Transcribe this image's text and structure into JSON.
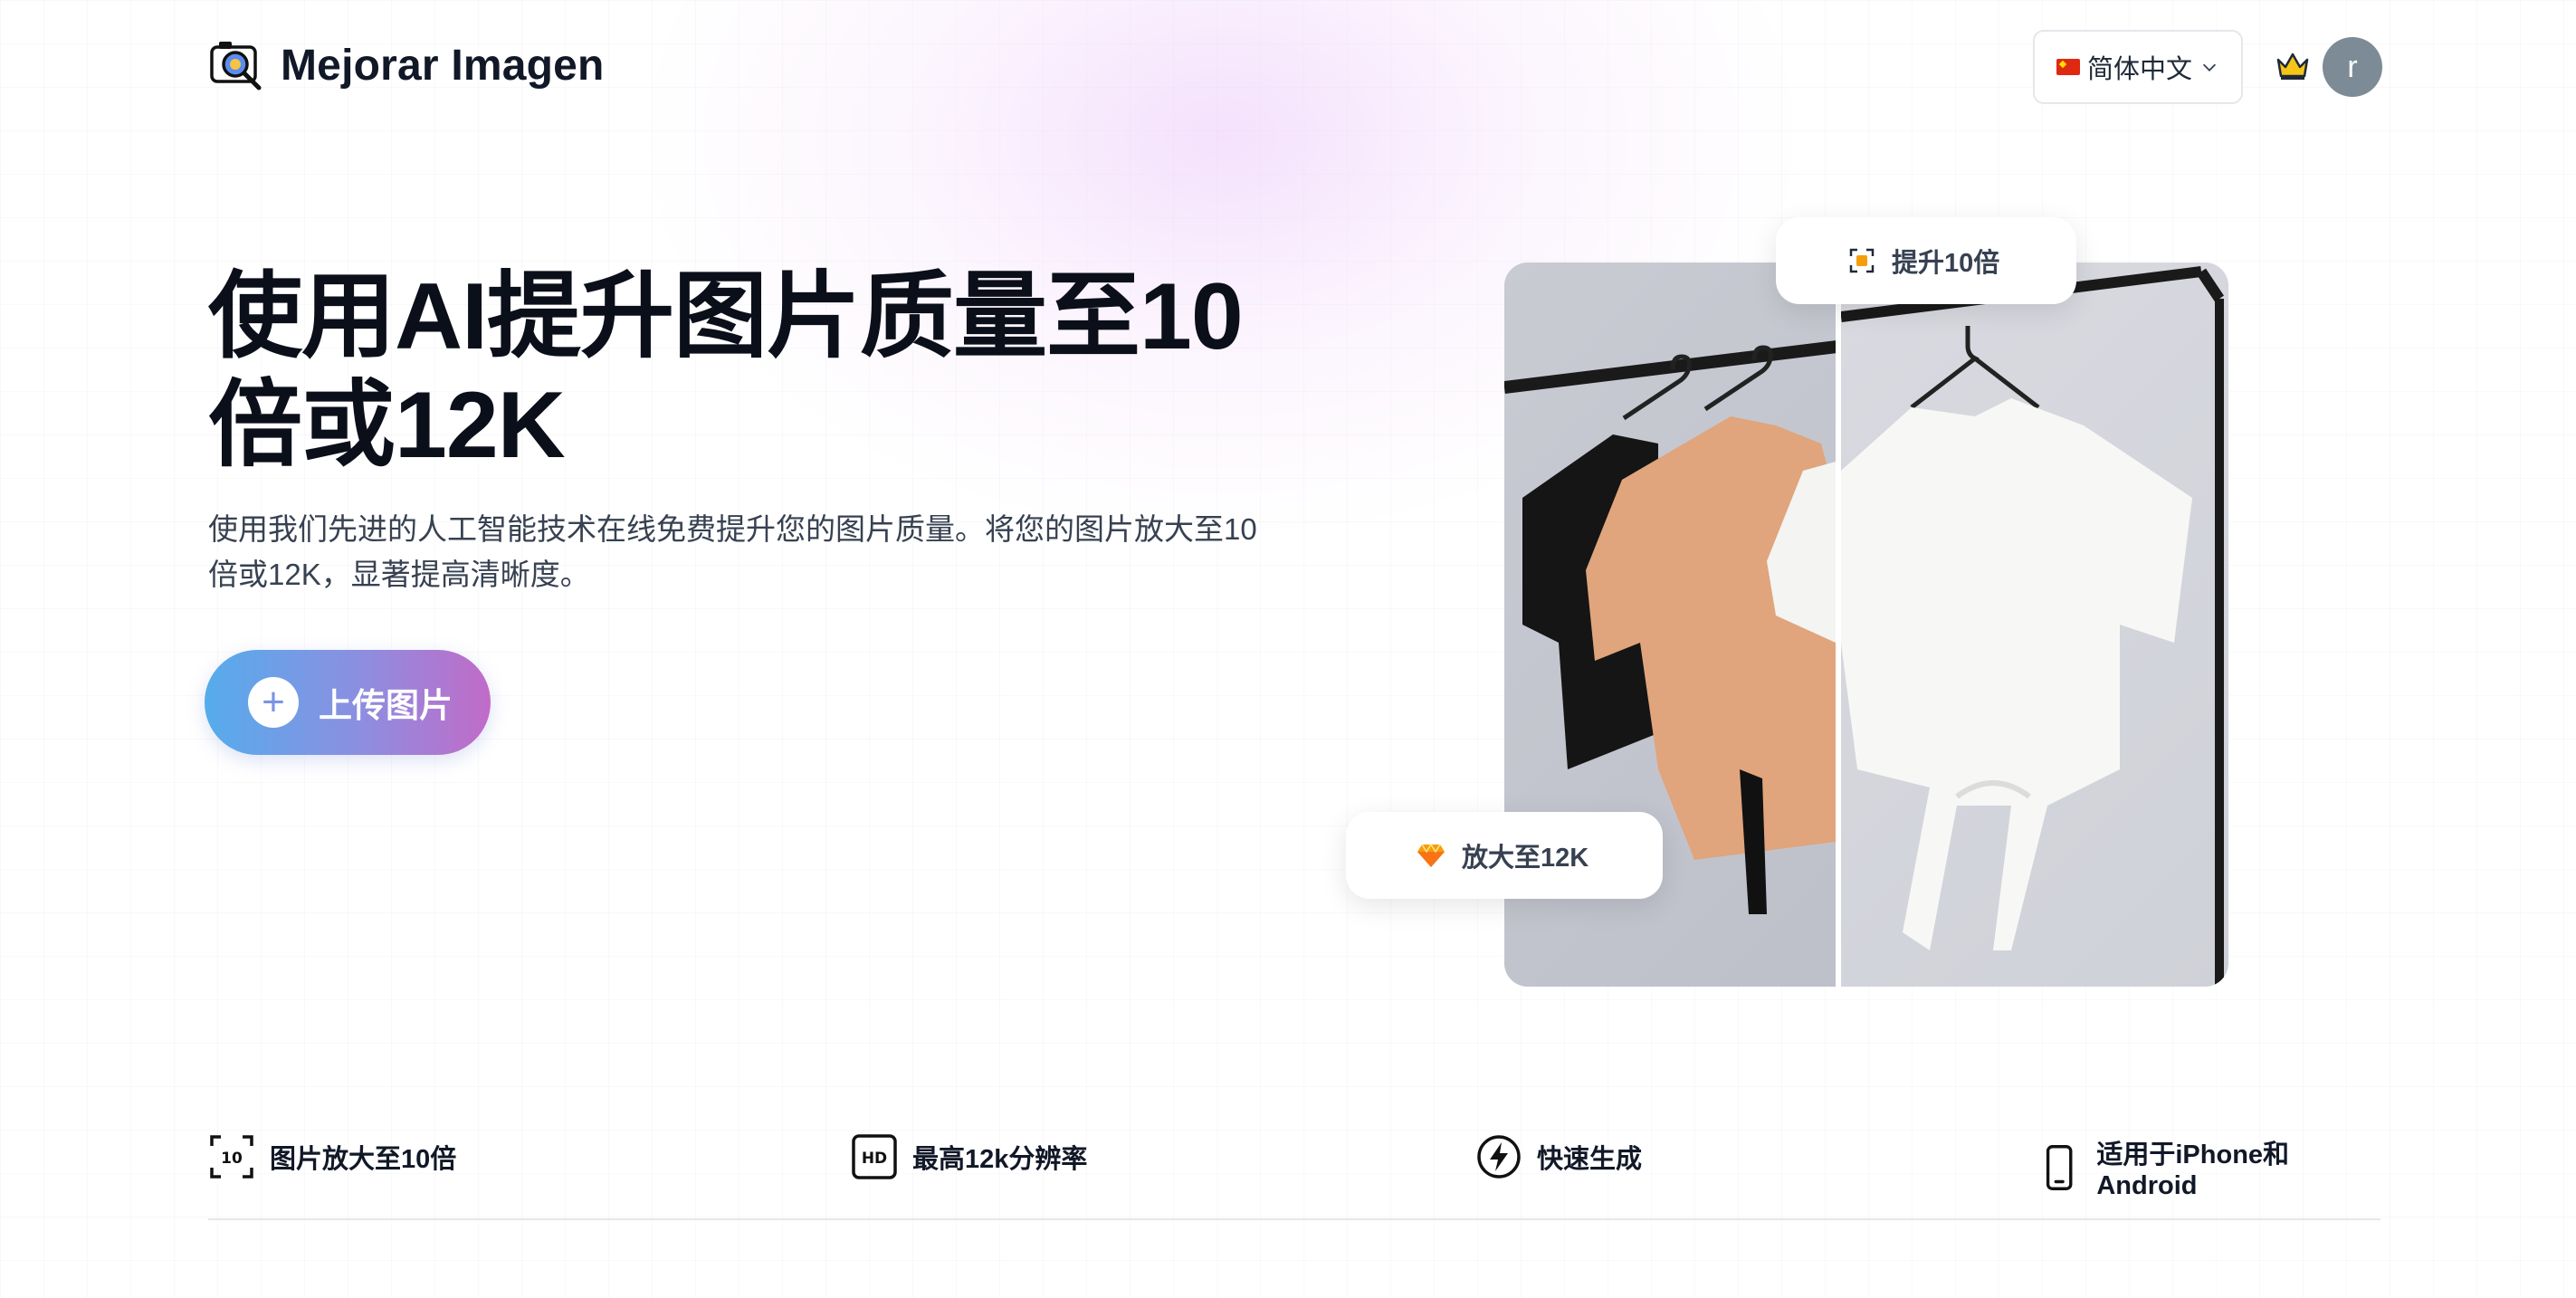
{
  "header": {
    "logo_text": "Mejorar Imagen",
    "language": "简体中文",
    "avatar_initial": "r"
  },
  "hero": {
    "title": "使用AI提升图片质量至10倍或12K",
    "subtitle": "使用我们先进的人工智能技术在线免费提升您的图片质量。将您的图片放大至10倍或12K，显著提高清晰度。",
    "upload_label": "上传图片"
  },
  "compare": {
    "badge_top": "提升10倍",
    "badge_bottom": "放大至12K"
  },
  "features": [
    {
      "icon": "scale-10x-icon",
      "label": "图片放大至10倍"
    },
    {
      "icon": "hd-icon",
      "label": "最高12k分辨率"
    },
    {
      "icon": "lightning-icon",
      "label": "快速生成"
    },
    {
      "icon": "phone-icon",
      "label": "适用于iPhone和Android"
    }
  ],
  "colors": {
    "button_gradient_start": "#55acec",
    "button_gradient_end": "#c16bc8",
    "avatar_bg": "#7c8b95"
  }
}
